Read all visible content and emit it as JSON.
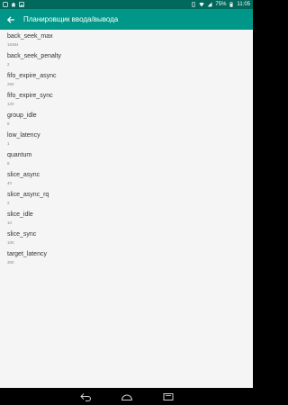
{
  "status_bar": {
    "battery": "75%",
    "time": "11:05"
  },
  "app_bar": {
    "title": "Планировщик ввода/вывода",
    "back_icon": "arrow-back-icon"
  },
  "items": [
    {
      "label": "back_seek_max",
      "value": "16384"
    },
    {
      "label": "back_seek_penalty",
      "value": "2"
    },
    {
      "label": "fifo_expire_async",
      "value": "250"
    },
    {
      "label": "fifo_expire_sync",
      "value": "120"
    },
    {
      "label": "group_idle",
      "value": "8"
    },
    {
      "label": "low_latency",
      "value": "1"
    },
    {
      "label": "quantum",
      "value": "8"
    },
    {
      "label": "slice_async",
      "value": "40"
    },
    {
      "label": "slice_async_rq",
      "value": "2"
    },
    {
      "label": "slice_idle",
      "value": "10"
    },
    {
      "label": "slice_sync",
      "value": "100"
    },
    {
      "label": "target_latency",
      "value": "300"
    }
  ],
  "nav_bar": {
    "back": "nav-back-icon",
    "home": "nav-home-icon",
    "recents": "nav-recents-icon"
  },
  "colors": {
    "primary": "#009688",
    "primary_dark": "#00695c",
    "background": "#f5f5f5"
  }
}
